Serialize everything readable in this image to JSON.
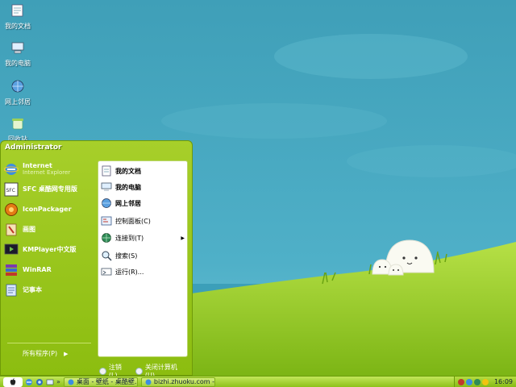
{
  "desktop": {
    "icons": [
      {
        "label": "我的文档",
        "icon": "my-documents-icon"
      },
      {
        "label": "我的电脑",
        "icon": "my-computer-icon"
      },
      {
        "label": "网上邻居",
        "icon": "network-places-icon"
      },
      {
        "label": "回收站",
        "icon": "recycle-bin-icon"
      }
    ]
  },
  "start_menu": {
    "user": "Administrator",
    "pinned": [
      {
        "label": "Internet",
        "sub": "Internet Explorer",
        "icon": "ie-icon"
      },
      {
        "label": "SFC 桌酷网专用版",
        "icon": "sfc-icon"
      },
      {
        "label": "IconPackager",
        "icon": "iconpackager-icon"
      },
      {
        "label": "画图",
        "icon": "paint-icon"
      },
      {
        "label": "KMPlayer中文版",
        "icon": "kmplayer-icon"
      },
      {
        "label": "WinRAR",
        "icon": "winrar-icon"
      },
      {
        "label": "记事本",
        "icon": "notepad-icon"
      }
    ],
    "all_programs": "所有程序(P)",
    "right": [
      {
        "label": "我的文档",
        "icon": "my-documents-icon"
      },
      {
        "label": "我的电脑",
        "icon": "my-computer-icon"
      },
      {
        "label": "网上邻居",
        "icon": "network-places-icon"
      },
      {
        "label": "控制面板(C)",
        "icon": "control-panel-icon"
      },
      {
        "label": "连接到(T)",
        "icon": "connect-to-icon"
      },
      {
        "label": "搜索(S)",
        "icon": "search-icon"
      },
      {
        "label": "运行(R)...",
        "icon": "run-icon"
      }
    ],
    "logoff": "注销(L)",
    "shutdown": "关闭计算机(U)"
  },
  "taskbar": {
    "quick_more": "»",
    "tasks": [
      {
        "label": "桌面 - 壁纸 - 桌酷壁..."
      },
      {
        "label": "bizhi.zhuoku.com - ..."
      }
    ],
    "clock": "16:09"
  },
  "colors": {
    "sky": "#4aa7c0",
    "hill": "#9fd12b",
    "menu_green": "#9ccb1f",
    "taskbar_green": "#a8d63a"
  }
}
